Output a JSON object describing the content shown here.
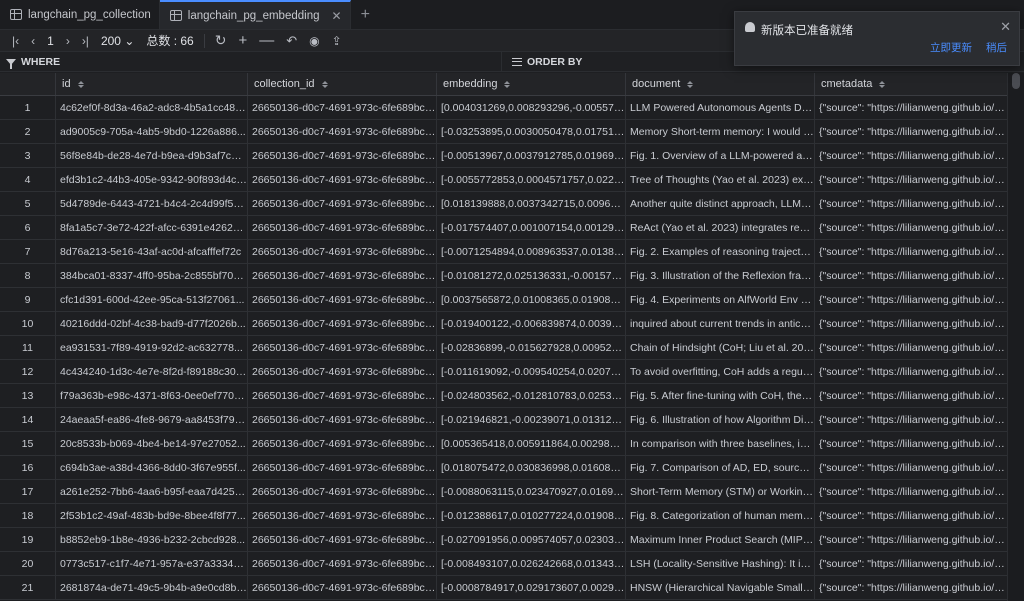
{
  "tabs": [
    {
      "label": "langchain_pg_collection",
      "active": false
    },
    {
      "label": "langchain_pg_embedding",
      "active": true
    }
  ],
  "toolbar": {
    "page": "1",
    "page_size": "200",
    "total_label": "总数 : 66"
  },
  "filter": {
    "where_label": "WHERE",
    "order_label": "ORDER BY"
  },
  "notification": {
    "title": "新版本已准备就绪",
    "update_now": "立即更新",
    "later": "稍后"
  },
  "columns": [
    "id",
    "collection_id",
    "embedding",
    "document",
    "cmetadata"
  ],
  "rows": [
    {
      "n": "1",
      "id": "4c62ef0f-8d3a-46a2-adc8-4b5a1cc483...",
      "cid": "26650136-d0c7-4691-973c-6fe689bca...",
      "emb": "[0.004031269,0.008293296,-0.005576...",
      "doc": "LLM Powered Autonomous Agents Date: Ju...",
      "meta": "{\"source\": \"https://lilianweng.github.io/posts..."
    },
    {
      "n": "2",
      "id": "ad9005c9-705a-4ab5-9bd0-1226a886...",
      "cid": "26650136-d0c7-4691-973c-6fe689bca...",
      "emb": "[-0.03253895,0.0030050478,0.017518...",
      "doc": "Memory Short-term memory: I would consid...",
      "meta": "{\"source\": \"https://lilianweng.github.io/posts..."
    },
    {
      "n": "3",
      "id": "56f8e84b-de28-4e7d-b9ea-d9b3af7c38...",
      "cid": "26650136-d0c7-4691-973c-6fe689bca...",
      "emb": "[-0.00513967,0.0037912785,0.019694...",
      "doc": "Fig. 1. Overview of a LLM-powered autonom...",
      "meta": "{\"source\": \"https://lilianweng.github.io/posts..."
    },
    {
      "n": "4",
      "id": "efd3b1c2-44b3-405e-9342-90f893d4cf...",
      "cid": "26650136-d0c7-4691-973c-6fe689bca...",
      "emb": "[-0.0055772853,0.0004571757,0.0224...",
      "doc": "Tree of Thoughts (Yao et al. 2023) extends ...",
      "meta": "{\"source\": \"https://lilianweng.github.io/posts..."
    },
    {
      "n": "5",
      "id": "5d4789de-6443-4721-b4c4-2c4d99f5d...",
      "cid": "26650136-d0c7-4691-973c-6fe689bca...",
      "emb": "[0.018139888,0.0037342715,0.009615...",
      "doc": "Another quite distinct approach, LLM+P (Liu...",
      "meta": "{\"source\": \"https://lilianweng.github.io/posts..."
    },
    {
      "n": "6",
      "id": "8fa1a5c7-3e72-422f-afcc-6391e4262e...",
      "cid": "26650136-d0c7-4691-973c-6fe689bca...",
      "emb": "[-0.017574407,0.001007154,0.001293...",
      "doc": "ReAct (Yao et al. 2023) integrates reasoning...",
      "meta": "{\"source\": \"https://lilianweng.github.io/posts..."
    },
    {
      "n": "7",
      "id": "8d76a213-5e16-43af-ac0d-afcafffef72c",
      "cid": "26650136-d0c7-4691-973c-6fe689bca...",
      "emb": "[-0.0071254894,0.008963537,0.01388...",
      "doc": "Fig. 2. Examples of reasoning trajectories for ...",
      "meta": "{\"source\": \"https://lilianweng.github.io/posts..."
    },
    {
      "n": "8",
      "id": "384bca01-8337-4ff0-95ba-2c855bf706...",
      "cid": "26650136-d0c7-4691-973c-6fe689bca...",
      "emb": "[-0.01081272,0.025136331,-0.001571...",
      "doc": "Fig. 3. Illustration of the Reflexion framework...",
      "meta": "{\"source\": \"https://lilianweng.github.io/posts..."
    },
    {
      "n": "9",
      "id": "cfc1d391-600d-42ee-95ca-513f27061...",
      "cid": "26650136-d0c7-4691-973c-6fe689bca...",
      "emb": "[0.0037565872,0.01008365,0.0190871...",
      "doc": "Fig. 4. Experiments on AlfWorld Env and Hot...",
      "meta": "{\"source\": \"https://lilianweng.github.io/posts..."
    },
    {
      "n": "10",
      "id": "40216ddd-02bf-4c38-bad9-d77f2026b...",
      "cid": "26650136-d0c7-4691-973c-6fe689bca...",
      "emb": "[-0.019400122,-0.006839874,0.00394...",
      "doc": "inquired about current trends in anticancer d...",
      "meta": "{\"source\": \"https://lilianweng.github.io/posts..."
    },
    {
      "n": "11",
      "id": "ea931531-7f89-4919-92d2-ac632778...",
      "cid": "26650136-d0c7-4691-973c-6fe689bca...",
      "emb": "[-0.02836899,-0.015627928,0.009521...",
      "doc": "Chain of Hindsight (CoH; Liu et al. 2023) en...",
      "meta": "{\"source\": \"https://lilianweng.github.io/posts..."
    },
    {
      "n": "12",
      "id": "4c434240-1d3c-4e7e-8f2d-f89188c30f...",
      "cid": "26650136-d0c7-4691-973c-6fe689bca...",
      "emb": "[-0.011619092,-0.009540254,0.02077...",
      "doc": "To avoid overfitting, CoH adds a regularizati...",
      "meta": "{\"source\": \"https://lilianweng.github.io/posts..."
    },
    {
      "n": "13",
      "id": "f79a363b-e98c-4371-8f63-0ee0ef7707...",
      "cid": "26650136-d0c7-4691-973c-6fe689bca...",
      "emb": "[-0.024803562,-0.012810783,0.02535...",
      "doc": "Fig. 5. After fine-tuning with CoH, the model ...",
      "meta": "{\"source\": \"https://lilianweng.github.io/posts..."
    },
    {
      "n": "14",
      "id": "24aeaa5f-ea86-4fe8-9679-aa8453f79f7d",
      "cid": "26650136-d0c7-4691-973c-6fe689bca...",
      "emb": "[-0.021946821,-0.00239071,0.013123...",
      "doc": "Fig. 6. Illustration of how Algorithm Distillatio...",
      "meta": "{\"source\": \"https://lilianweng.github.io/posts..."
    },
    {
      "n": "15",
      "id": "20c8533b-b069-4be4-be14-97e27052...",
      "cid": "26650136-d0c7-4691-973c-6fe689bca...",
      "emb": "[0.005365418,0.005911864,0.0029832...",
      "doc": "In comparison with three baselines, including...",
      "meta": "{\"source\": \"https://lilianweng.github.io/posts..."
    },
    {
      "n": "16",
      "id": "c694b3ae-a38d-4366-8dd0-3f67e955f...",
      "cid": "26650136-d0c7-4691-973c-6fe689bca...",
      "emb": "[0.018075472,0.030836998,0.0160894...",
      "doc": "Fig. 7. Comparison of AD, ED, source policy a...",
      "meta": "{\"source\": \"https://lilianweng.github.io/posts..."
    },
    {
      "n": "17",
      "id": "a261e252-7bb6-4aa6-b95f-eaa7d425b...",
      "cid": "26650136-d0c7-4691-973c-6fe689bca...",
      "emb": "[-0.0088063115,0.023470927,0.01694...",
      "doc": "Short-Term Memory (STM) or Working Mem...",
      "meta": "{\"source\": \"https://lilianweng.github.io/posts..."
    },
    {
      "n": "18",
      "id": "2f53b1c2-49af-483b-bd9e-8bee4f8f77...",
      "cid": "26650136-d0c7-4691-973c-6fe689bca...",
      "emb": "[-0.012388617,0.010277224,0.019089...",
      "doc": "Fig. 8. Categorization of human memory. We...",
      "meta": "{\"source\": \"https://lilianweng.github.io/posts..."
    },
    {
      "n": "19",
      "id": "b8852eb9-1b8e-4936-b232-2cbcd928...",
      "cid": "26650136-d0c7-4691-973c-6fe689bca...",
      "emb": "[-0.027091956,0.009574057,0.023030...",
      "doc": "Maximum Inner Product Search (MIPS)# Th...",
      "meta": "{\"source\": \"https://lilianweng.github.io/posts..."
    },
    {
      "n": "20",
      "id": "0773c517-c1f7-4e71-957a-e37a33341...",
      "cid": "26650136-d0c7-4691-973c-6fe689bca...",
      "emb": "[-0.008493107,0.026242668,0.013430...",
      "doc": "LSH (Locality-Sensitive Hashing): It introduc...",
      "meta": "{\"source\": \"https://lilianweng.github.io/posts..."
    },
    {
      "n": "21",
      "id": "2681874a-de71-49c5-9b4b-a9e0cd8b8...",
      "cid": "26650136-d0c7-4691-973c-6fe689bca...",
      "emb": "[-0.0008784917,0.029173607,0.00293...",
      "doc": "HNSW (Hierarchical Navigable Small World)...",
      "meta": "{\"source\": \"https://lilianweng.github.io/posts..."
    }
  ]
}
